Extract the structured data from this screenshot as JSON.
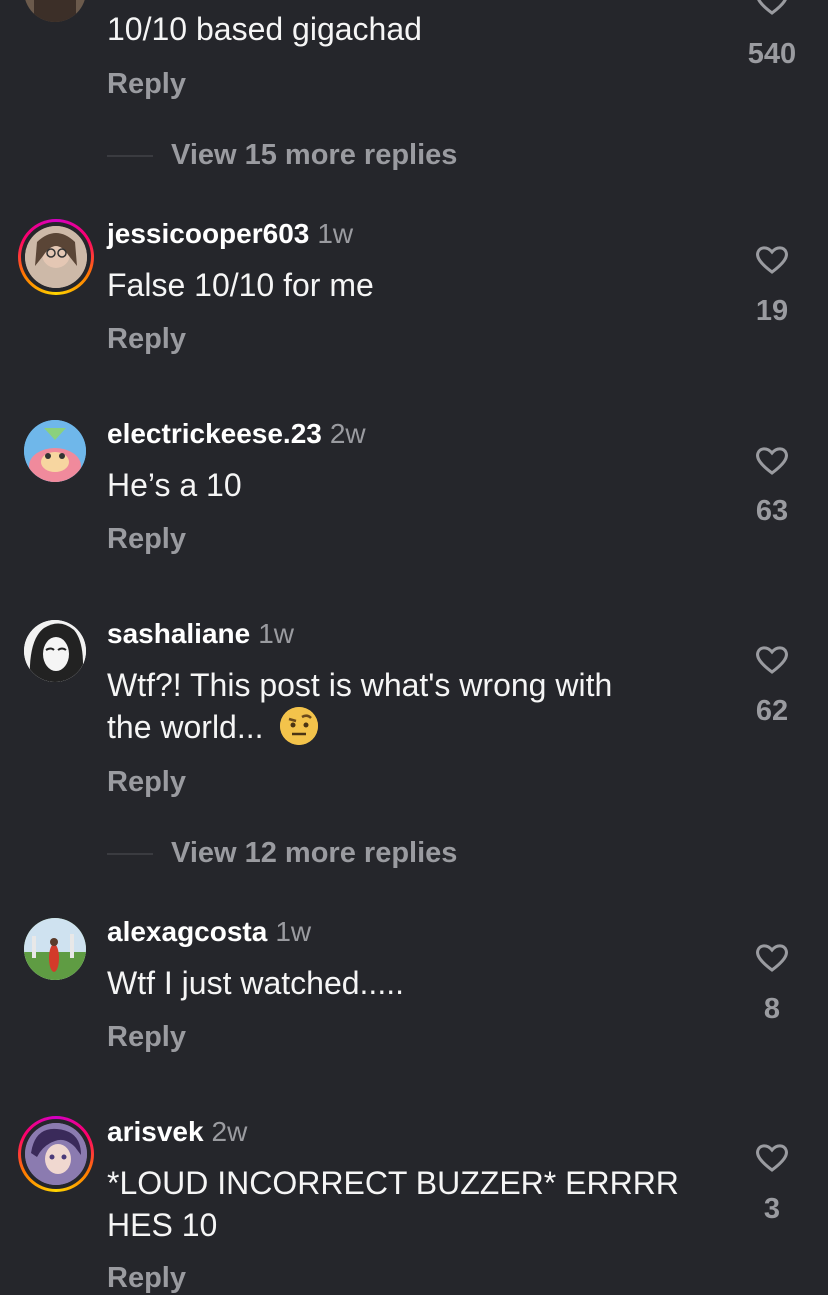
{
  "comments": [
    {
      "username": "",
      "time": "",
      "text": "10/10 based gigachad",
      "reply_label": "Reply",
      "likes": "540",
      "view_more": "View 15 more replies"
    },
    {
      "username": "jessicooper603",
      "time": "1w",
      "text": "False 10/10 for me",
      "reply_label": "Reply",
      "likes": "19"
    },
    {
      "username": "electrickeese.23",
      "time": "2w",
      "text": "He’s a 10",
      "reply_label": "Reply",
      "likes": "63"
    },
    {
      "username": "sashaliane",
      "time": "1w",
      "text_line1": "Wtf?! This post is what's wrong with",
      "text_line2": "the world...",
      "emoji": "raised-eyebrow-emoji",
      "reply_label": "Reply",
      "likes": "62",
      "view_more": "View 12 more replies"
    },
    {
      "username": "alexagcosta",
      "time": "1w",
      "text": "Wtf I just watched.....",
      "reply_label": "Reply",
      "likes": "8"
    },
    {
      "username": "arisvek",
      "time": "2w",
      "text_line1": "*LOUD INCORRECT BUZZER* ERRRR",
      "text_line2": "HES 10",
      "reply_label": "Reply",
      "likes": "3"
    }
  ],
  "colors": {
    "background": "#25262b",
    "secondary_text": "#9a9ba0",
    "story_ring": "#ff0069"
  }
}
